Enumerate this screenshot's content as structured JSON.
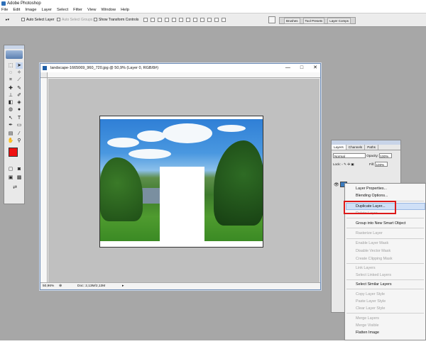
{
  "app": {
    "title": "Adobe Photoshop"
  },
  "menu": [
    "File",
    "Edit",
    "Image",
    "Layer",
    "Select",
    "Filter",
    "View",
    "Window",
    "Help"
  ],
  "options_bar": {
    "auto_select_layer": "Auto Select Layer",
    "auto_select_groups": "Auto Select Groups",
    "show_transform_controls": "Show Transform Controls"
  },
  "panel_well": [
    "Brushes",
    "Tool Presets",
    "Layer Comps"
  ],
  "document": {
    "title": "landscape-1665069_960_720.jpg @ 50,9% (Layer 0, RGB/8#)",
    "zoom": "50,96%",
    "doc_size": "Doc: 2,13M/2,13M",
    "win_buttons": [
      "—",
      "□",
      "✕"
    ]
  },
  "layers_panel": {
    "tabs": [
      "Layers",
      "Channels",
      "Paths"
    ],
    "blend_mode": "Normal",
    "opacity_label": "Opacity:",
    "opacity_value": "100%",
    "lock_label": "Lock:",
    "fill_label": "Fill:",
    "fill_value": "100%"
  },
  "context_menu": {
    "items": [
      {
        "label": "Layer Properties...",
        "enabled": true
      },
      {
        "label": "Blending Options...",
        "enabled": true
      },
      {
        "label": "Duplicate Layer...",
        "enabled": true,
        "highlighted": true
      },
      {
        "label": "Delete Layer",
        "enabled": false
      },
      {
        "label": "Group into New Smart Object",
        "enabled": true
      },
      {
        "label": "Rasterize Layer",
        "enabled": false
      },
      {
        "label": "Enable Layer Mask",
        "enabled": false
      },
      {
        "label": "Disable Vector Mask",
        "enabled": false
      },
      {
        "label": "Create Clipping Mask",
        "enabled": false
      },
      {
        "label": "Link Layers",
        "enabled": false
      },
      {
        "label": "Select Linked Layers",
        "enabled": false
      },
      {
        "label": "Select Similar Layers",
        "enabled": true
      },
      {
        "label": "Copy Layer Style",
        "enabled": false
      },
      {
        "label": "Paste Layer Style",
        "enabled": false
      },
      {
        "label": "Clear Layer Style",
        "enabled": false
      },
      {
        "label": "Merge Layers",
        "enabled": false
      },
      {
        "label": "Merge Visible",
        "enabled": false
      },
      {
        "label": "Flatten Image",
        "enabled": true
      }
    ]
  },
  "colors": {
    "foreground": "#ee1111",
    "background": "#ffffff",
    "highlight": "#dd1a1a"
  }
}
